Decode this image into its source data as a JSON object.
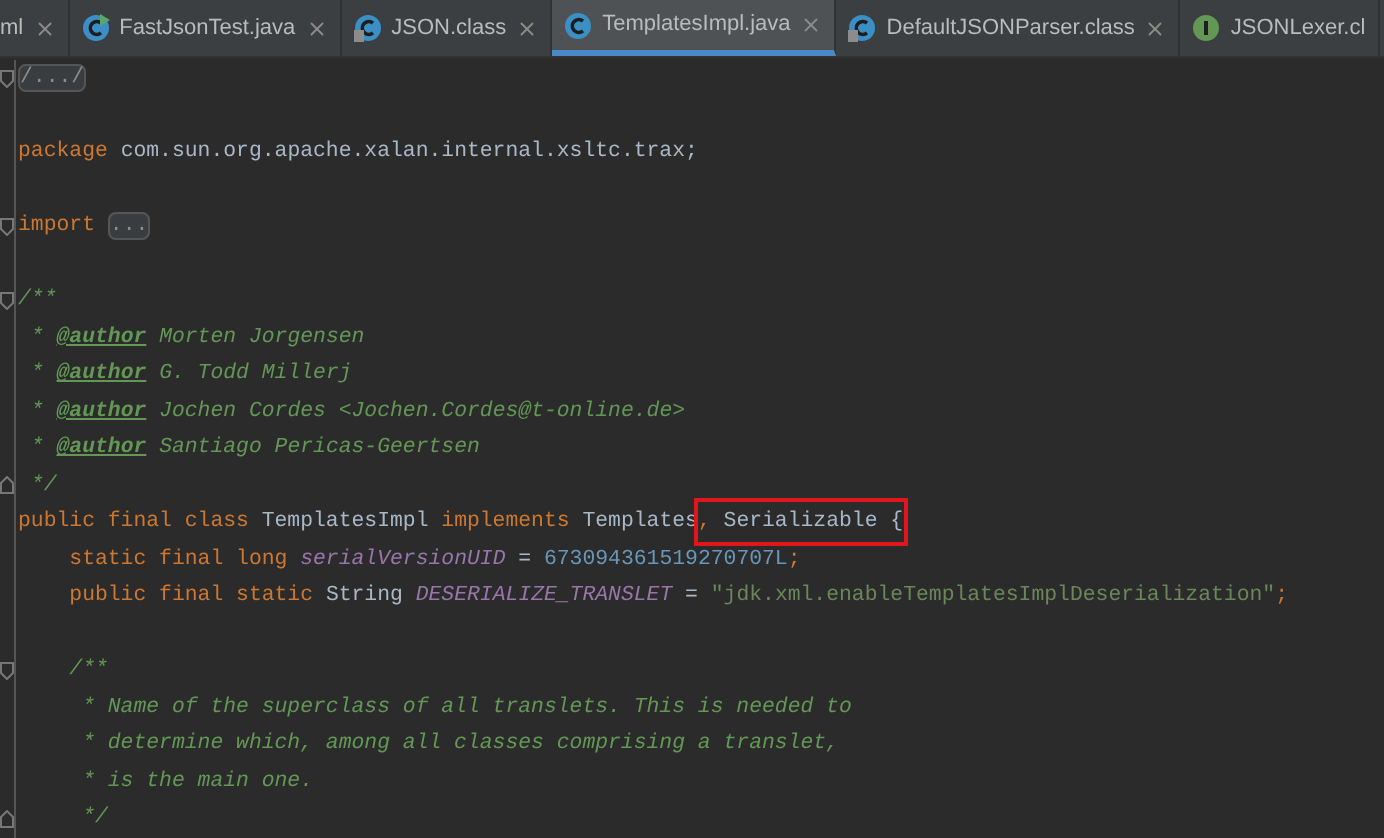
{
  "tabs": [
    {
      "label": "ml",
      "kind": "plain",
      "closable": true,
      "selected": false
    },
    {
      "label": "FastJsonTest.java",
      "kind": "runnable-class",
      "closable": true,
      "selected": false
    },
    {
      "label": "JSON.class",
      "kind": "compiled-class",
      "closable": true,
      "selected": false
    },
    {
      "label": "TemplatesImpl.java",
      "kind": "class",
      "closable": true,
      "selected": true
    },
    {
      "label": "DefaultJSONParser.class",
      "kind": "compiled-class",
      "closable": true,
      "selected": false
    },
    {
      "label": "JSONLexer.cl",
      "kind": "interface",
      "closable": false,
      "selected": false
    }
  ],
  "code_lines": [
    {
      "kind": "fold-start",
      "tokens": [
        {
          "kind": "folded",
          "text": "/.../"
        }
      ]
    },
    {
      "kind": "code"
    },
    {
      "kind": "code",
      "tokens": [
        {
          "kind": "keyword",
          "text": "package "
        },
        {
          "kind": "plain",
          "text": "com.sun.org.apache.xalan.internal.xsltc.trax;"
        }
      ]
    },
    {
      "kind": "code"
    },
    {
      "kind": "fold-start",
      "tokens": [
        {
          "kind": "keyword",
          "text": "import "
        },
        {
          "kind": "folded",
          "text": "..."
        }
      ]
    },
    {
      "kind": "code"
    },
    {
      "kind": "fold-start",
      "tokens": [
        {
          "kind": "comment",
          "text": "/**"
        }
      ]
    },
    {
      "kind": "code",
      "tokens": [
        {
          "kind": "comment",
          "text": " * "
        },
        {
          "kind": "doc-tag",
          "text": "@author"
        },
        {
          "kind": "comment",
          "text": " Morten Jorgensen"
        }
      ]
    },
    {
      "kind": "code",
      "tokens": [
        {
          "kind": "comment",
          "text": " * "
        },
        {
          "kind": "doc-tag",
          "text": "@author"
        },
        {
          "kind": "comment",
          "text": " G. Todd Millerj"
        }
      ]
    },
    {
      "kind": "code",
      "tokens": [
        {
          "kind": "comment",
          "text": " * "
        },
        {
          "kind": "doc-tag",
          "text": "@author"
        },
        {
          "kind": "comment",
          "text": " Jochen Cordes <Jochen.Cordes@t-online.de>"
        }
      ]
    },
    {
      "kind": "code",
      "tokens": [
        {
          "kind": "comment",
          "text": " * "
        },
        {
          "kind": "doc-tag",
          "text": "@author"
        },
        {
          "kind": "comment",
          "text": " Santiago Pericas-Geertsen"
        }
      ]
    },
    {
      "kind": "fold-end",
      "tokens": [
        {
          "kind": "comment",
          "text": " */"
        }
      ]
    },
    {
      "kind": "code",
      "tokens": [
        {
          "kind": "keyword",
          "text": "public final class "
        },
        {
          "kind": "plain",
          "text": "TemplatesImpl "
        },
        {
          "kind": "keyword",
          "text": "implements "
        },
        {
          "kind": "plain",
          "text": "Templates"
        },
        {
          "kind": "group",
          "boxed": true,
          "tokens": [
            {
              "kind": "keyword",
              "text": ", "
            },
            {
              "kind": "plain",
              "text": "Serializable {"
            }
          ]
        }
      ]
    },
    {
      "kind": "code",
      "tokens": [
        {
          "kind": "keyword",
          "text": "    static final long "
        },
        {
          "kind": "field",
          "text": "serialVersionUID"
        },
        {
          "kind": "plain",
          "text": " = "
        },
        {
          "kind": "number",
          "text": "673094361519270707L"
        },
        {
          "kind": "keyword",
          "text": ";"
        }
      ]
    },
    {
      "kind": "code",
      "tokens": [
        {
          "kind": "keyword",
          "text": "    public final static "
        },
        {
          "kind": "plain",
          "text": "String "
        },
        {
          "kind": "field",
          "text": "DESERIALIZE_TRANSLET"
        },
        {
          "kind": "plain",
          "text": " = "
        },
        {
          "kind": "string",
          "text": "\"jdk.xml.enableTemplatesImplDeserialization\""
        },
        {
          "kind": "keyword",
          "text": ";"
        }
      ]
    },
    {
      "kind": "code"
    },
    {
      "kind": "fold-start",
      "tokens": [
        {
          "kind": "comment",
          "text": "    /**"
        }
      ]
    },
    {
      "kind": "code",
      "tokens": [
        {
          "kind": "comment",
          "text": "     * Name of the superclass of all translets. This is needed to"
        }
      ]
    },
    {
      "kind": "code",
      "tokens": [
        {
          "kind": "comment",
          "text": "     * determine which, among all classes comprising a translet,"
        }
      ]
    },
    {
      "kind": "code",
      "tokens": [
        {
          "kind": "comment",
          "text": "     * is the main one."
        }
      ]
    },
    {
      "kind": "fold-end",
      "tokens": [
        {
          "kind": "comment",
          "text": "     */"
        }
      ]
    }
  ]
}
